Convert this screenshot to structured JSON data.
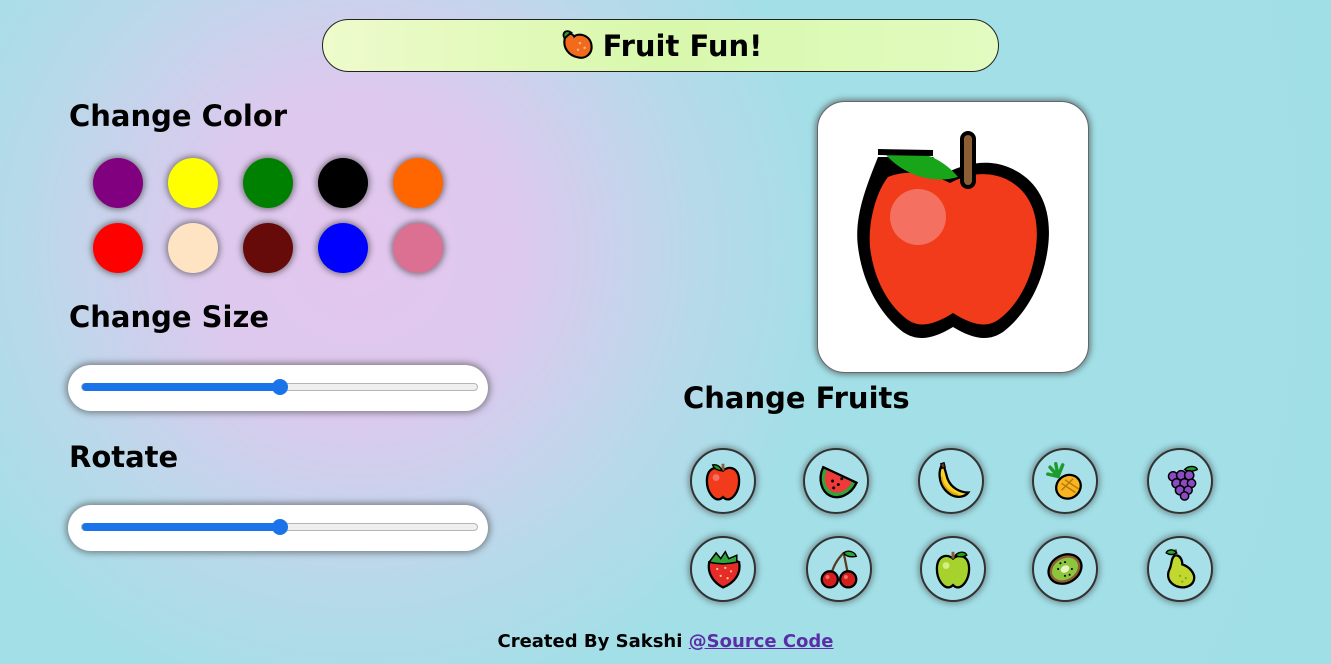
{
  "header": {
    "title": "Fruit Fun!",
    "icon": "mango-icon"
  },
  "color_section": {
    "heading": "Change Color",
    "swatches": [
      "#800080",
      "#ffff00",
      "#008000",
      "#000000",
      "#ff6600",
      "#ff0000",
      "#ffe4c4",
      "#660a0a",
      "#0000ff",
      "#db7093"
    ]
  },
  "size_section": {
    "heading": "Change Size",
    "value": 50,
    "min": 0,
    "max": 100
  },
  "rotate_section": {
    "heading": "Rotate",
    "value": 50,
    "min": 0,
    "max": 100
  },
  "preview": {
    "fruit": "apple-icon"
  },
  "fruits_section": {
    "heading": "Change Fruits",
    "fruits": [
      "apple",
      "watermelon",
      "banana",
      "pineapple",
      "grapes",
      "strawberry",
      "cherries",
      "green-apple",
      "kiwi",
      "pear"
    ]
  },
  "footer": {
    "text": "Created By Sakshi",
    "link": "@Source Code"
  }
}
